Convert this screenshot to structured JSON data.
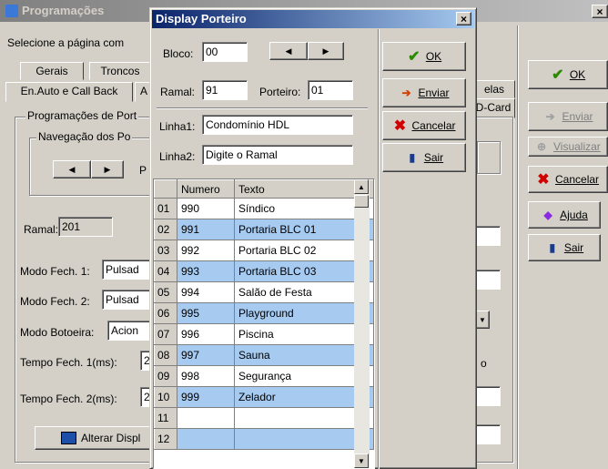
{
  "bg_window": {
    "title": "Programações",
    "close_glyph": "×",
    "select_label": "Selecione a página com",
    "tabs_row1": [
      "Gerais",
      "Troncos",
      "elas"
    ],
    "tabs_row2": [
      "En.Auto e Call Back",
      "A",
      "D-Card"
    ],
    "group_outer": "Programações de Port",
    "group_nav": "Navegação dos Po",
    "nav_extra": "P",
    "ramal_label": "Ramal:",
    "ramal_value": "201",
    "modo1_label": "Modo Fech. 1:",
    "modo1_value": "Pulsad",
    "modo2_label": "Modo Fech. 2:",
    "modo2_value": "Pulsad",
    "botoeira_label": "Modo Botoeira:",
    "botoeira_value": "Acion",
    "tempo1_label": "Tempo Fech. 1(ms):",
    "tempo1_value": "2",
    "tempo2_label": "Tempo Fech. 2(ms):",
    "tempo2_value": "2",
    "alterar_button": "Alterar Displ",
    "right_frag_o": "o"
  },
  "side_buttons": {
    "ok": "OK",
    "enviar": "Enviar",
    "visualizar": "Visualizar",
    "cancelar": "Cancelar",
    "ajuda": "Ajuda",
    "sair": "Sair"
  },
  "dialog": {
    "title": "Display Porteiro",
    "close_glyph": "×",
    "bloco_label": "Bloco:",
    "bloco_value": "00",
    "ramal_label": "Ramal:",
    "ramal_value": "91",
    "porteiro_label": "Porteiro:",
    "porteiro_value": "01",
    "linha1_label": "Linha1:",
    "linha1_value": "Condomínio HDL",
    "linha2_label": "Linha2:",
    "linha2_value": "Digite o Ramal",
    "buttons": {
      "ok": "OK",
      "enviar": "Enviar",
      "cancelar": "Cancelar",
      "sair": "Sair"
    },
    "table": {
      "columns": [
        "Numero",
        "Texto"
      ],
      "rows": [
        {
          "idx": "01",
          "numero": "990",
          "texto": "Síndico",
          "selected": false
        },
        {
          "idx": "02",
          "numero": "991",
          "texto": "Portaria BLC 01",
          "selected": true
        },
        {
          "idx": "03",
          "numero": "992",
          "texto": "Portaria BLC 02",
          "selected": false
        },
        {
          "idx": "04",
          "numero": "993",
          "texto": "Portaria BLC 03",
          "selected": true
        },
        {
          "idx": "05",
          "numero": "994",
          "texto": "Salão de Festa",
          "selected": false
        },
        {
          "idx": "06",
          "numero": "995",
          "texto": "Playground",
          "selected": true
        },
        {
          "idx": "07",
          "numero": "996",
          "texto": "Piscina",
          "selected": false
        },
        {
          "idx": "08",
          "numero": "997",
          "texto": "Sauna",
          "selected": true
        },
        {
          "idx": "09",
          "numero": "998",
          "texto": "Segurança",
          "selected": false
        },
        {
          "idx": "10",
          "numero": "999",
          "texto": "Zelador",
          "selected": true
        },
        {
          "idx": "11",
          "numero": "",
          "texto": "",
          "selected": false
        },
        {
          "idx": "12",
          "numero": "",
          "texto": "",
          "selected": true
        }
      ]
    }
  },
  "colors": {
    "selection": "#a6caf0",
    "titlebar": "#0a246a",
    "ok_check": "#2a8a00",
    "cancel_x": "#d00000"
  }
}
